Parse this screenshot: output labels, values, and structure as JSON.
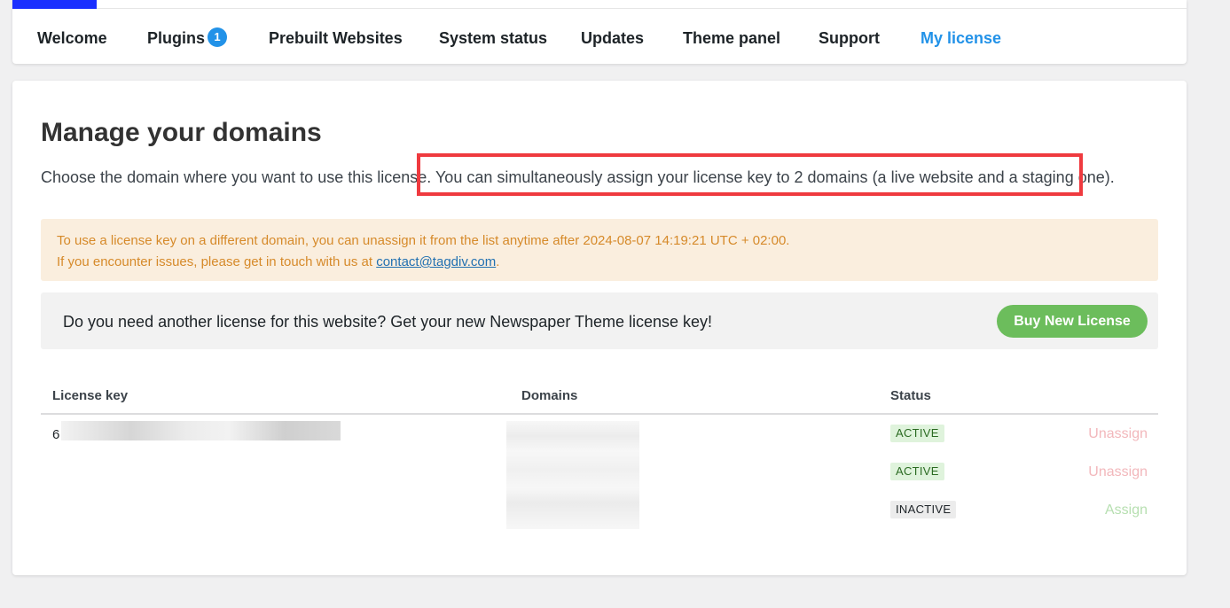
{
  "nav": {
    "items": [
      {
        "label": "Welcome"
      },
      {
        "label": "Plugins",
        "badge": "1"
      },
      {
        "label": "Prebuilt Websites"
      },
      {
        "label": "System status"
      },
      {
        "label": "Updates"
      },
      {
        "label": "Theme panel"
      },
      {
        "label": "Support"
      },
      {
        "label": "My license",
        "active": true
      }
    ]
  },
  "main": {
    "title": "Manage your domains",
    "intro_part1": "Choose the domain where you want to use this license.",
    "intro_part2": "You can simultaneously assign your license key to 2 domains (a live website and a staging one).",
    "notice": {
      "line1": "To use a license key on a different domain, you can unassign it from the list anytime after 2024-08-07 14:19:21 UTC + 02:00.",
      "line2_prefix": "If you encounter issues, please get in touch with us at ",
      "email": "contact@tagdiv.com",
      "line2_suffix": "."
    },
    "promo": {
      "text": "Do you need another license for this website? Get your new Newspaper Theme license key!",
      "button_label": "Buy New License"
    },
    "table": {
      "headers": {
        "license_key": "License key",
        "domains": "Domains",
        "status": "Status"
      },
      "license_key_visible": "6",
      "rows": [
        {
          "status": "ACTIVE",
          "action": "Unassign"
        },
        {
          "status": "ACTIVE",
          "action": "Unassign"
        },
        {
          "status": "INACTIVE",
          "action": "Assign"
        }
      ]
    }
  },
  "colors": {
    "accent": "#2292e8",
    "highlight_border": "#ef3a3f",
    "buy_button": "#6cbd5c",
    "notice_bg": "#faeede",
    "notice_text": "#d68a2a"
  }
}
